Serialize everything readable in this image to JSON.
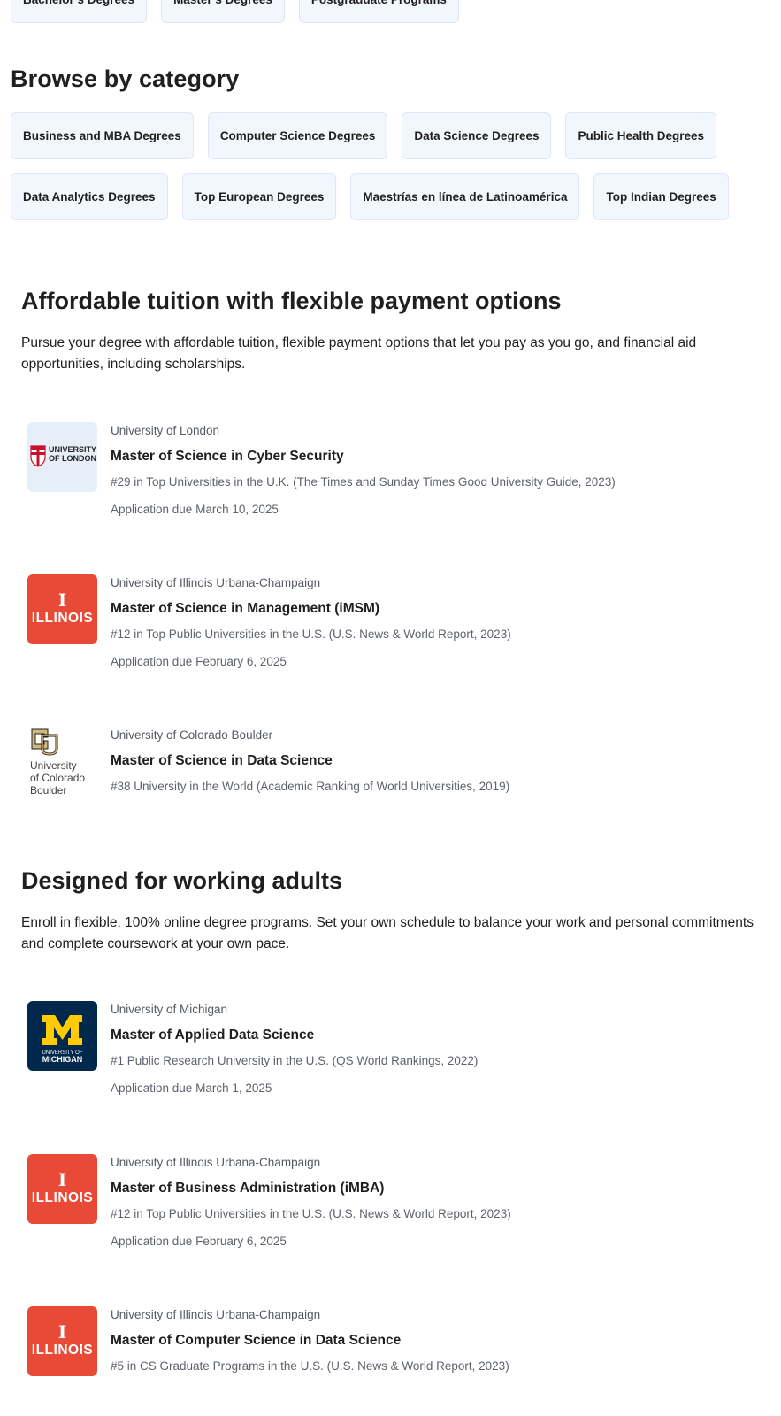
{
  "top_chips": [
    "Bachelor’s Degrees",
    "Master’s Degrees",
    "Postgraduate Programs"
  ],
  "browse": {
    "title": "Browse by category",
    "row1": [
      "Business and MBA Degrees",
      "Computer Science Degrees",
      "Data Science Degrees",
      "Public Health Degrees"
    ],
    "row2": [
      "Data Analytics Degrees",
      "Top European Degrees",
      "Maestrías en línea de Latinoamérica",
      "Top Indian Degrees"
    ]
  },
  "affordable": {
    "title": "Affordable tuition with flexible payment options",
    "description": "Pursue your degree with affordable tuition, flexible payment options that let you pay as you go, and financial aid opportunities, including scholarships.",
    "programs": [
      {
        "partner": "University of London",
        "title": "Master of Science in Cyber Security",
        "rank": "#29 in Top Universities in the U.K. (The Times and Sunday Times Good University Guide, 2023)",
        "due": "Application due March 10, 2025",
        "logo_icon": "university-of-london-logo",
        "logo_text": "UNIVERSITY OF LONDON"
      },
      {
        "partner": "University of Illinois Urbana-Champaign",
        "title": "Master of Science in Management (iMSM)",
        "rank": "#12 in Top Public Universities in the U.S. (U.S. News & World Report, 2023)",
        "due": "Application due February 6, 2025",
        "logo_icon": "illinois-logo",
        "logo_text": "ILLINOIS"
      },
      {
        "partner": "University of Colorado Boulder",
        "title": "Master of Science in Data Science",
        "rank": "#38 University in the World (Academic Ranking of World Universities, 2019)",
        "due": "",
        "logo_icon": "colorado-boulder-logo",
        "logo_text": "University of Colorado Boulder"
      }
    ]
  },
  "working": {
    "title": "Designed for working adults",
    "description": "Enroll in flexible, 100% online degree programs. Set your own schedule to balance your work and personal commitments and complete coursework at your own pace.",
    "programs": [
      {
        "partner": "University of Michigan",
        "title": "Master of Applied Data Science",
        "rank": "#1 Public Research University in the U.S. (QS World Rankings, 2022)",
        "due": "Application due March 1, 2025",
        "logo_icon": "michigan-logo",
        "logo_text": "UNIVERSITY OF MICHIGAN"
      },
      {
        "partner": "University of Illinois Urbana-Champaign",
        "title": "Master of Business Administration (iMBA)",
        "rank": "#12 in Top Public Universities in the U.S. (U.S. News & World Report, 2023)",
        "due": "Application due February 6, 2025",
        "logo_icon": "illinois-logo",
        "logo_text": "ILLINOIS"
      },
      {
        "partner": "University of Illinois Urbana-Champaign",
        "title": "Master of Computer Science in Data Science",
        "rank": "#5 in CS Graduate Programs in the U.S. (U.S. News & World Report, 2023)",
        "due": "",
        "logo_icon": "illinois-logo",
        "logo_text": "ILLINOIS"
      }
    ]
  },
  "colors": {
    "chip_bg": "#f2f6fd",
    "illinois_orange": "#e84a37",
    "michigan_blue": "#00274c",
    "michigan_maize": "#ffcb05",
    "london_red": "#c8102e"
  }
}
